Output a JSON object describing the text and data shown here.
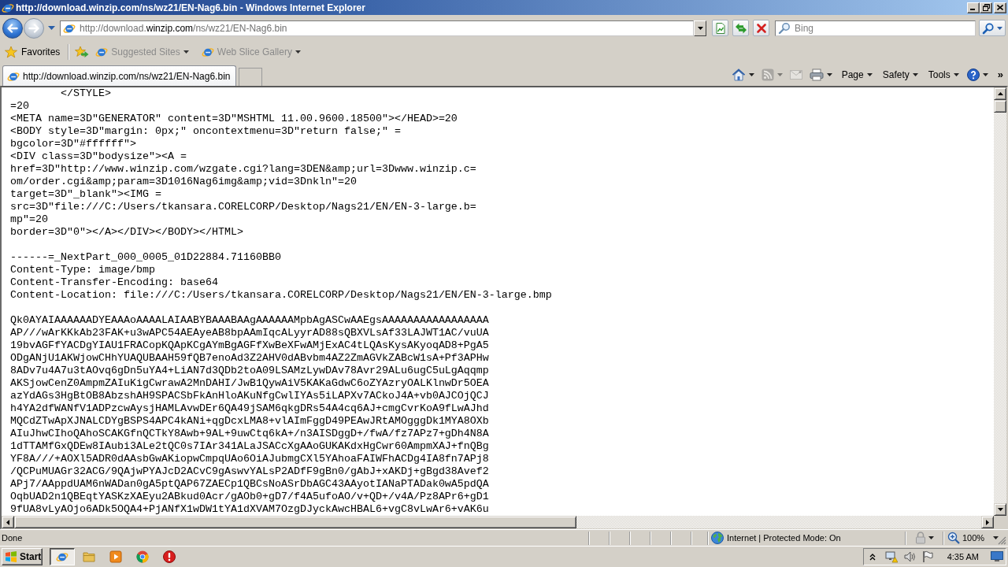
{
  "window": {
    "title": "http://download.winzip.com/ns/wz21/EN-Nag6.bin - Windows Internet Explorer"
  },
  "address_bar": {
    "value": "http://download.**winzip.com**/ns/wz21/EN-Nag6.bin"
  },
  "search": {
    "placeholder": "Bing"
  },
  "favorites_bar": {
    "label": "Favorites",
    "items": [
      {
        "label": "Suggested Sites",
        "disabled": true
      },
      {
        "label": "Web Slice Gallery",
        "disabled": true
      }
    ]
  },
  "tabs": [
    {
      "label": "http://download.winzip.com/ns/wz21/EN-Nag6.bin",
      "selected": true
    }
  ],
  "command_bar": {
    "tool_buttons": [
      {
        "disabled": false
      },
      {
        "disabled": true
      },
      {
        "disabled": true
      },
      {
        "disabled": false
      }
    ],
    "menus": [
      {
        "label": "Page"
      },
      {
        "label": "Safety"
      },
      {
        "label": "Tools"
      }
    ],
    "overflow": "»"
  },
  "document": {
    "blocks": [
      {
        "lines": [
          "        </STYLE>",
          "=20",
          "<META name=3D\"GENERATOR\" content=3D\"MSHTML 11.00.9600.18500\"></HEAD>=20",
          "<BODY style=3D\"margin: 0px;\" oncontextmenu=3D\"return false;\" =",
          "bgcolor=3D\"#ffffff\">",
          "<DIV class=3D\"bodysize\"><A =",
          "href=3D\"http://www.winzip.com/wzgate.cgi?lang=3DEN&amp;url=3Dwww.winzip.c=",
          "om/order.cgi&amp;param=3D1016Nag6img&amp;vid=3Dnkln\"=20",
          "target=3D\"_blank\"><IMG =",
          "src=3D\"file:///C:/Users/tkansara.CORELCORP/Desktop/Nags21/EN/EN-3-large.b=",
          "mp\"=20",
          "border=3D\"0\"></A></DIV></BODY></HTML>"
        ]
      },
      {
        "lines": [
          "------=_NextPart_000_0005_01D22884.71160BB0",
          "Content-Type: image/bmp",
          "Content-Transfer-Encoding: base64",
          "Content-Location: file:///C:/Users/tkansara.CORELCORP/Desktop/Nags21/EN/EN-3-large.bmp"
        ]
      },
      {
        "lines": [
          "Qk0AYAIAAAAAADYEAAAoAAAALAIAABYBAAABAAgAAAAAAMpbAgASCwAAEgsAAAAAAAAAAAAAAAAA",
          "AP///wArKKkAb23FAK+u3wAPC54AEAyeAB8bpAAmIqcALyyrAD88sQBXVLsAf33LAJWT1AC/vuUA",
          "19bvAGFfYACDgYIAU1FRACopKQApKCgAYmBgAGFfXwBeXFwAMjExAC4tLQAsKysAKyoqAD8+PgA5",
          "ODgANjU1AKWjowCHhYUAQUBAAH59fQB7enoAd3Z2AHV0dABvbm4AZ2ZmAGVkZABcW1sA+Pf3APHw",
          "8ADv7u4A7u3tAOvq6gDn5uYA4+LiAN7d3QDb2toA09LSAMzLywDAv78Avr29ALu6ugC5uLgAqqmp",
          "AKSjowCenZ0AmpmZAIuKigCwrawA2MnDAHI/JwB1QywAiV5KAKaGdwC6oZYAzryOALKlnwDr5OEA",
          "azYdAGs3HgBtOB8AbzshAH9SPACSbFkAnHloAKuNfgCwlIYAs5iLAPXv7ACkoJ4A+vb0AJCOjQCJ",
          "h4YA2dfWANfV1ADPzcwAysjHAMLAvwDEr6QA49jSAM6qkgDRs54A4cq6AJ+cmgCvrKoA9fLwAJhd",
          "MQCdZTwApXJNALCDYgBSPS4APC4kANi+qgDcxLMA8+vlAImFggD49PEAwJRtAMOgggDk1MYA8OXb",
          "AIuJhwCIhoQAhoSCAKGfnQCTkY8Awb+9AL+9uwCtq6kA+/n3AISDggD+/fwA/fz7APz7+gDh4N8A",
          "1dTTAMfGxQDEw8IAubi3ALe2tQC0s7IAr341ALaJSACcXgAAoGUKAKdxHgCwr60AmpmXAJ+fnQBg",
          "YF8A///+AOXl5ADR0dAAsbGwAKiopwCmpqUAo6OiAJubmgCXl5YAhoaFAIWFhACDg4IA8fn7APj8",
          "/QCPuMUAGr32ACG/9QAjwPYAJcD2ACvC9gAswvYALsP2ADfF9gBn0/gAbJ+xAKDj+gBgd38Avef2",
          "APj7/AAppdUAM6nWADan0gA5ptQAP67ZAECp1QBCsNoASrDbAGC43AAyotIANaPTADak0wA5pdQA",
          "OqbUAD2n1QBEqtYASKzXAEyu2ABkud0Acr/gAOb0+gD7/f4A5ufoAO/v+QD+/v4A/Pz8APr6+gD1",
          "9fUA8vLyAOjo6ADk5OQA4+PjANfX1wDW1tYA1dXVAM7OzgDJyckAwcHBAL6+vgC8vLwAr6+vAK6u"
        ]
      }
    ]
  },
  "status_bar": {
    "text": "Done",
    "zone": "Internet | Protected Mode: On",
    "zoom": "100%"
  },
  "taskbar": {
    "start": "Start",
    "apps": [
      {
        "selected": true
      },
      {
        "selected": false
      },
      {
        "selected": false
      },
      {
        "selected": false
      },
      {
        "selected": false
      }
    ],
    "clock": "4:35 AM"
  }
}
